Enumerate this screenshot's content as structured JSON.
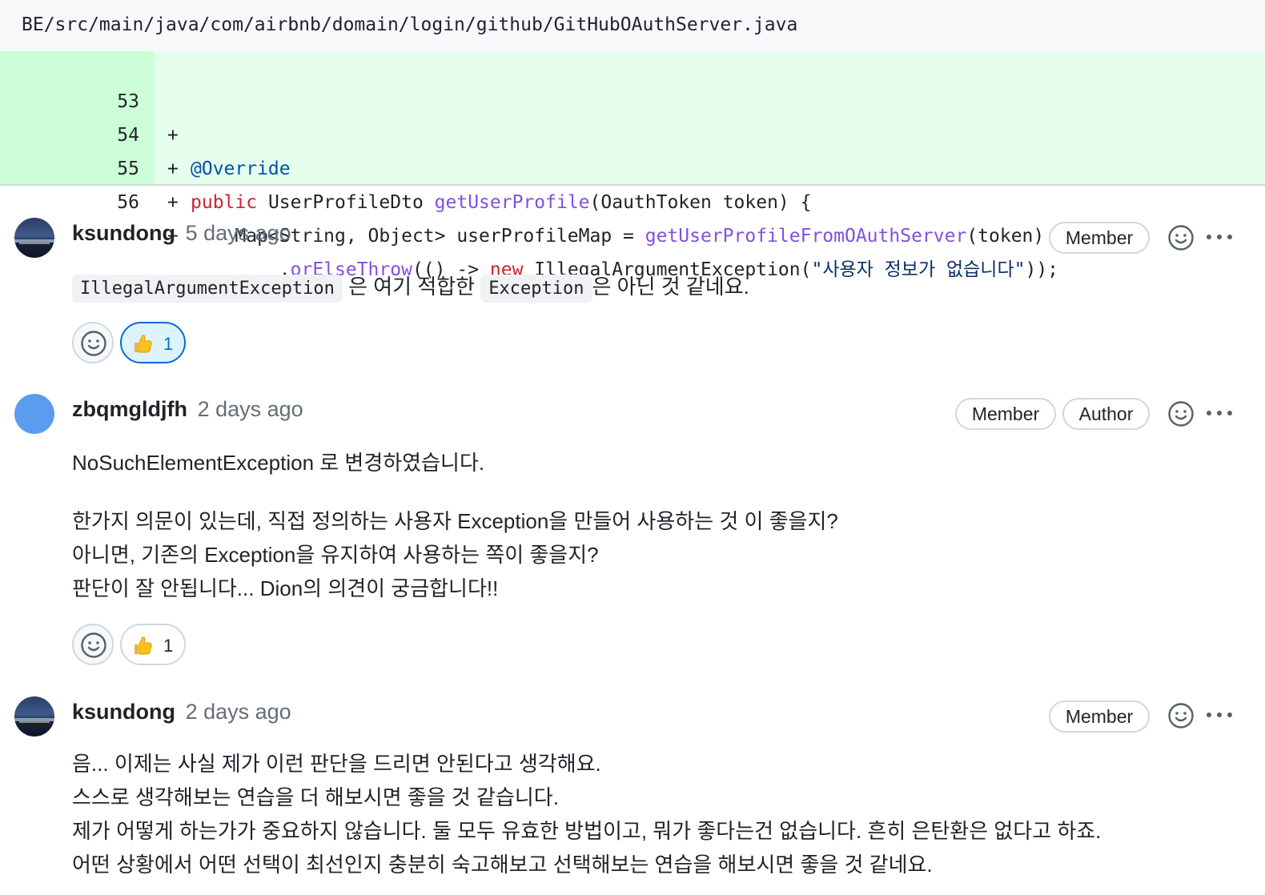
{
  "file": {
    "path": "BE/src/main/java/com/airbnb/domain/login/github/GitHubOAuthServer.java"
  },
  "diff": {
    "lines": [
      {
        "number": "53",
        "marker": "+"
      },
      {
        "number": "54",
        "marker": "+"
      },
      {
        "number": "55",
        "marker": "+"
      },
      {
        "number": "56",
        "marker": "+"
      }
    ],
    "tokens": {
      "l53_annotation": "@Override",
      "l54_public": "public",
      "l54_type": " UserProfileDto ",
      "l54_method": "getUserProfile",
      "l54_rest": "(OauthToken token) {",
      "l55_lead": "    Map<String, Object> userProfileMap = ",
      "l55_method": "getUserProfileFromOAuthServer",
      "l55_rest": "(token)",
      "l56_lead": "        .",
      "l56_method": "orElseThrow",
      "l56_arrow": "(() -> ",
      "l56_new": "new",
      "l56_cls": " IllegalArgumentException(",
      "l56_str": "\"사용자 정보가 없습니다\"",
      "l56_end": "));"
    }
  },
  "comments": [
    {
      "username": "ksundong",
      "time": "5 days ago",
      "badges": [
        "Member"
      ],
      "body": {
        "code1": "IllegalArgumentException",
        "text1": " 은 여기 적합한 ",
        "code2": "Exception",
        "text2": "은 아닌 것 같네요."
      },
      "reaction": {
        "emoji": "thumbs-up",
        "count": "1",
        "reacted": true
      }
    },
    {
      "username": "zbqmgldjfh",
      "time": "2 days ago",
      "badges": [
        "Member",
        "Author"
      ],
      "body": {
        "p1": "NoSuchElementException 로 변경하였습니다.",
        "p2_l1": "한가지 의문이 있는데, 직접 정의하는 사용자 Exception을 만들어 사용하는 것 이 좋을지?",
        "p2_l2": "아니면, 기존의 Exception을 유지하여 사용하는 쪽이 좋을지?",
        "p2_l3": "판단이 잘 안됩니다... Dion의 의견이 궁금합니다!!"
      },
      "reaction": {
        "emoji": "thumbs-up",
        "count": "1",
        "reacted": false
      }
    },
    {
      "username": "ksundong",
      "time": "2 days ago",
      "badges": [
        "Member"
      ],
      "body": {
        "l1": "음... 이제는 사실 제가 이런 판단을 드리면 안된다고 생각해요.",
        "l2": "스스로 생각해보는 연습을 더 해보시면 좋을 것 같습니다.",
        "l3": "제가 어떻게 하는가가 중요하지 않습니다. 둘 모두 유효한 방법이고, 뭐가 좋다는건 없습니다. 흔히 은탄환은 없다고 하죠.",
        "l4": "어떤 상황에서 어떤 선택이 최선인지 충분히 숙고해보고 선택해보는 연습을 해보시면 좋을 것 같네요."
      }
    }
  ],
  "colors": {
    "diff_added_bg": "#e6ffec",
    "diff_added_gutter": "#ccffd8",
    "keyword": "#cf222e",
    "function": "#8250df",
    "annotation": "#0550ae",
    "reacted_bg": "#ddf4ff",
    "reacted_border": "#0969da"
  },
  "icons": [
    "smiley-icon",
    "kebab-horizontal-icon",
    "thumbs-up-emoji"
  ]
}
